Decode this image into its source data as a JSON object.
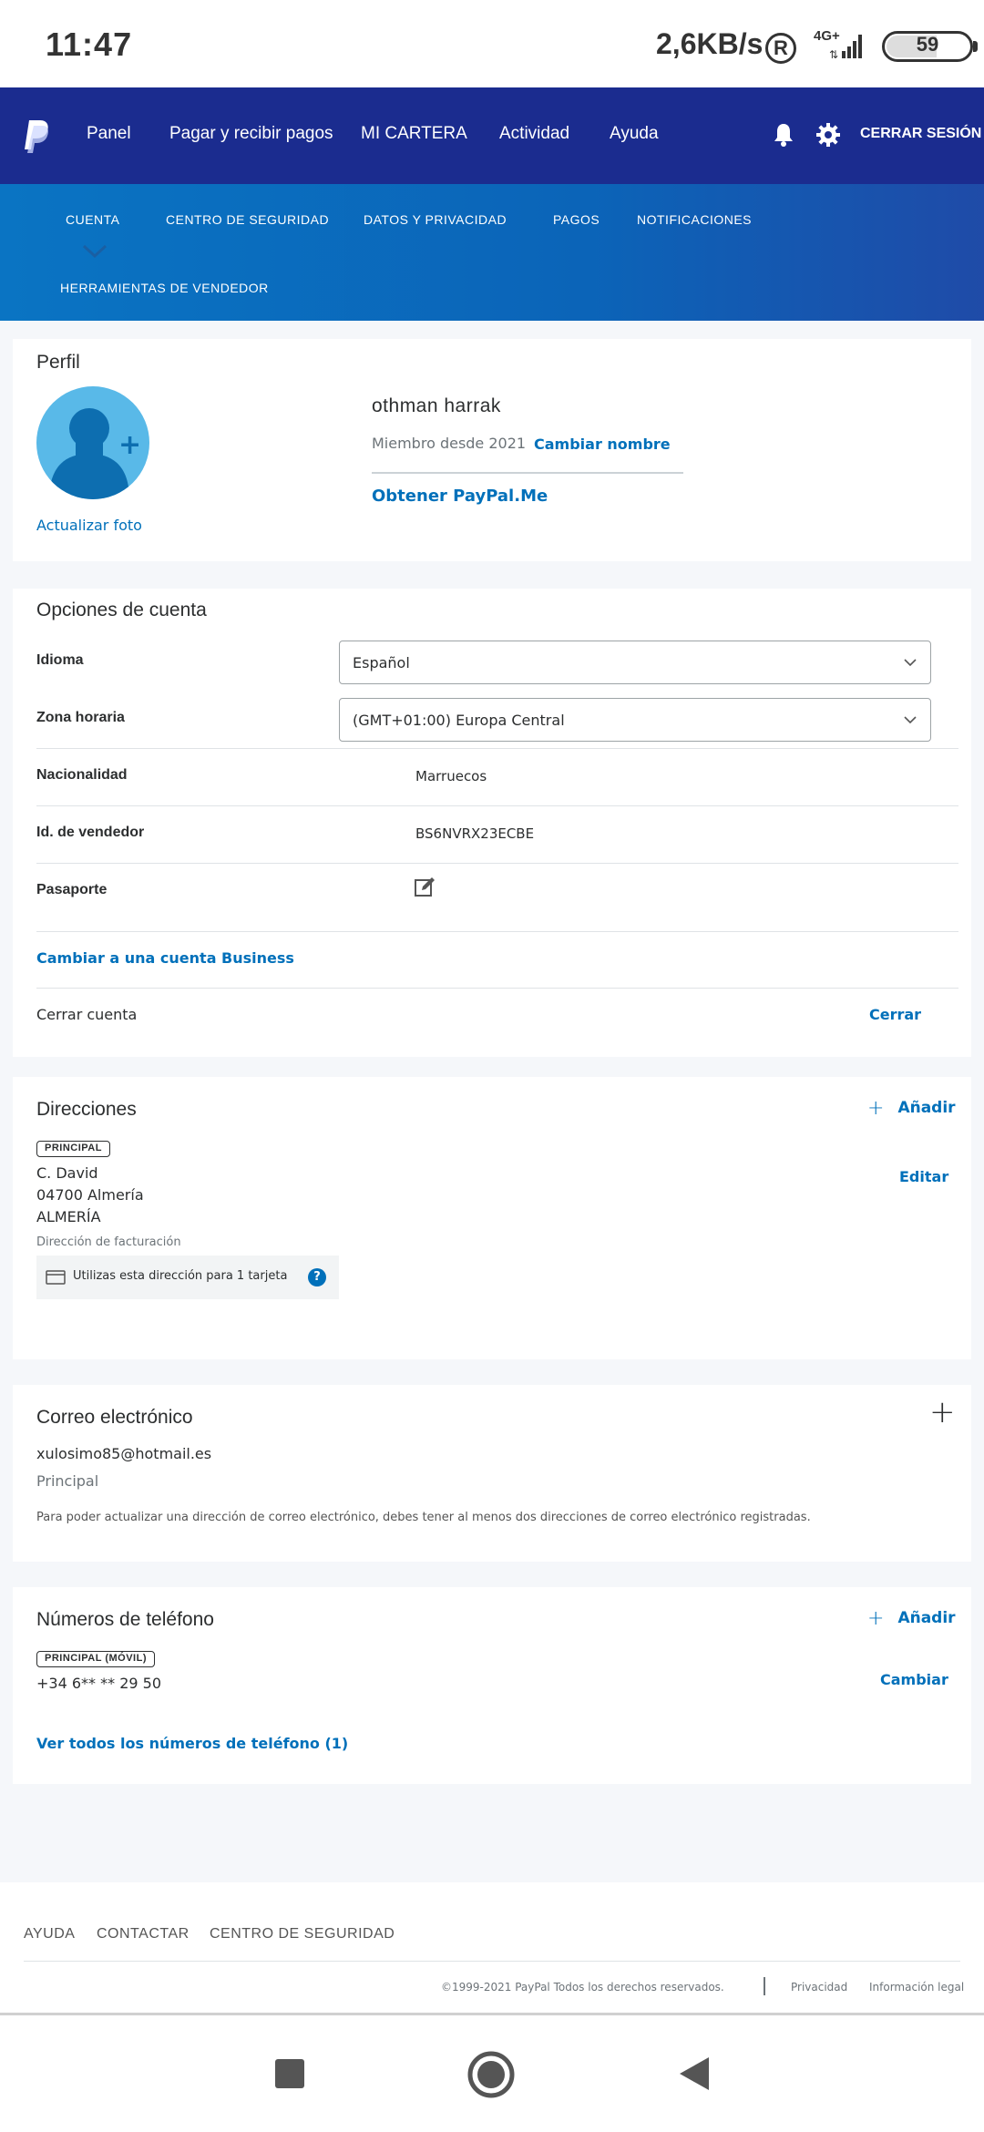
{
  "status": {
    "time": "11:47",
    "speed": "2,6KB/s",
    "registered": "R",
    "network": "4G+",
    "battery": "59"
  },
  "topnav": {
    "items": [
      "Panel",
      "Pagar y recibir pagos",
      "MI CARTERA",
      "Actividad",
      "Ayuda"
    ],
    "logout": "CERRAR SESIÓN"
  },
  "subnav": {
    "items": [
      "CUENTA",
      "CENTRO DE SEGURIDAD",
      "DATOS Y PRIVACIDAD",
      "PAGOS",
      "NOTIFICACIONES",
      "HERRAMIENTAS DE VENDEDOR"
    ]
  },
  "profile": {
    "title": "Perfil",
    "update_photo": "Actualizar foto",
    "name": "othman harrak",
    "member_since": "Miembro desde 2021",
    "change_name": "Cambiar nombre",
    "paypal_me": "Obtener PayPal.Me"
  },
  "account_options": {
    "title": "Opciones de cuenta",
    "language_label": "Idioma",
    "language_value": "Español",
    "timezone_label": "Zona horaria",
    "timezone_value": "(GMT+01:00) Europa Central",
    "nationality_label": "Nacionalidad",
    "nationality_value": "Marruecos",
    "seller_id_label": "Id. de vendedor",
    "seller_id_value": "BS6NVRX23ECBE",
    "passport_label": "Pasaporte",
    "business_link": "Cambiar a una cuenta Business",
    "close_account_label": "Cerrar cuenta",
    "close_link": "Cerrar"
  },
  "addresses": {
    "title": "Direcciones",
    "add": "Añadir",
    "badge": "PRINCIPAL",
    "lines": [
      "C. David",
      "04700 Almería",
      "ALMERÍA"
    ],
    "billing": "Dirección de facturación",
    "edit": "Editar",
    "card_note": "Utilizas esta dirección para 1 tarjeta",
    "help": "?"
  },
  "email": {
    "title": "Correo electrónico",
    "add_symbol": "+",
    "address": "xulosimo85@hotmail.es",
    "primary": "Principal",
    "note": "Para poder actualizar una dirección de correo electrónico, debes tener al menos dos direcciones de correo electrónico registradas."
  },
  "phones": {
    "title": "Números de teléfono",
    "add": "Añadir",
    "badge": "PRINCIPAL (MÓVIL)",
    "number": "+34 6** ** 29 50",
    "change": "Cambiar",
    "view_all": "Ver todos los números de teléfono (1)"
  },
  "footer": {
    "links": [
      "AYUDA",
      "CONTACTAR",
      "CENTRO DE SEGURIDAD"
    ],
    "copyright": "©1999-2021 PayPal Todos los derechos reservados.",
    "privacy": "Privacidad",
    "legal": "Información legal"
  },
  "colors": {
    "nav_dark": "#1b2c8f",
    "nav_blue": "#0a74c3",
    "link": "#0070ba",
    "avatar": "#59b9e8"
  }
}
